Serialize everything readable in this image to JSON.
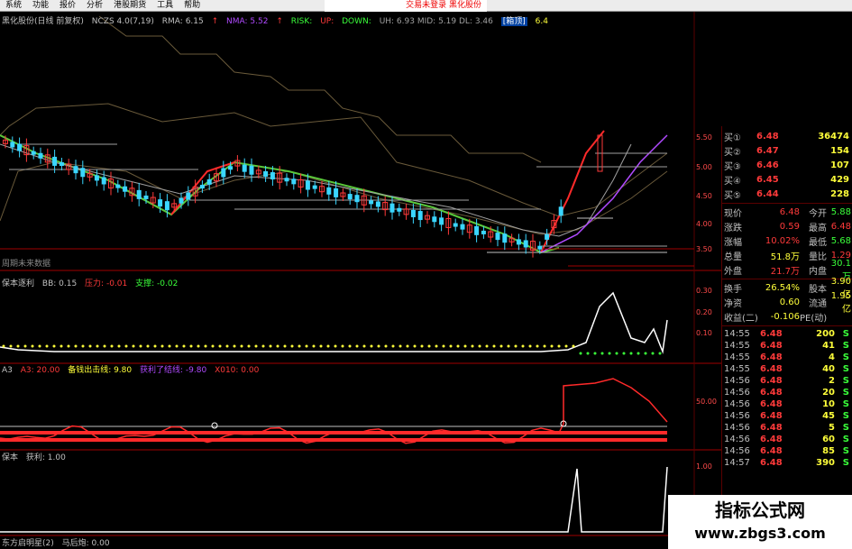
{
  "menu": [
    "系统",
    "功能",
    "报价",
    "分析",
    "港股期货",
    "工具",
    "帮助"
  ],
  "trade_text": "交易未登录  黑化股份",
  "price_header": {
    "title": "黑化股份(日线 前复权)",
    "ncz": "NCZS 4.0(7,19)",
    "rma": "RMA: 6.15",
    "nma": "NMA: 5.52",
    "risk": "RISK:",
    "up": "UP:",
    "down": "DOWN:",
    "stats": "UH: 6.93  MID: 5.19  DL: 3.46",
    "tag": "[箱顶]",
    "tag_val": "6.4"
  },
  "subtitle_main": "周期未来数据",
  "ind1": {
    "name": "保本逐利",
    "bb": "BB: 0.15",
    "yl": "压力: -0.01",
    "zc": "支撑: -0.02"
  },
  "ind2": {
    "name": "A3",
    "a3": "A3: 20.00",
    "cj": "备钱出击线: 9.80",
    "hl": "获利了结线: -9.80",
    "x": "X010: 0.00"
  },
  "ind3": {
    "name": "保本",
    "gain": "获利: 1.00"
  },
  "ind4": {
    "name": "东方启明星(2)",
    "mp": "马后炮: 0.00"
  },
  "axis_main": [
    "5.50",
    "5.00",
    "4.50",
    "4.00",
    "3.50"
  ],
  "axis_ind1": [
    "0.30",
    "0.20",
    "0.10"
  ],
  "axis_ind2": [
    "50.00"
  ],
  "axis_ind3": [
    "1.00"
  ],
  "quotes": [
    {
      "label": "买①",
      "price": "6.48",
      "vol": "36474"
    },
    {
      "label": "买②",
      "price": "6.47",
      "vol": "154"
    },
    {
      "label": "买③",
      "price": "6.46",
      "vol": "107"
    },
    {
      "label": "买④",
      "price": "6.45",
      "vol": "429"
    },
    {
      "label": "买⑤",
      "price": "6.44",
      "vol": "228"
    }
  ],
  "stats": [
    {
      "l1": "现价",
      "v1": "6.48",
      "c1": "#ff3a3a",
      "l2": "今开",
      "v2": "5.88",
      "c2": "#3aff3a"
    },
    {
      "l1": "涨跌",
      "v1": "0.59",
      "c1": "#ff3a3a",
      "l2": "最高",
      "v2": "6.48",
      "c2": "#ff3a3a"
    },
    {
      "l1": "涨幅",
      "v1": "10.02%",
      "c1": "#ff3a3a",
      "l2": "最低",
      "v2": "5.68",
      "c2": "#3aff3a"
    },
    {
      "l1": "总量",
      "v1": "51.8万",
      "c1": "#ffff3a",
      "l2": "量比",
      "v2": "1.29",
      "c2": "#ff3a3a"
    },
    {
      "l1": "外盘",
      "v1": "21.7万",
      "c1": "#ff3a3a",
      "l2": "内盘",
      "v2": "30.1万",
      "c2": "#3aff3a"
    }
  ],
  "stats2": [
    {
      "l1": "换手",
      "v1": "26.54%",
      "c1": "#ffff3a",
      "l2": "股本",
      "v2": "3.90亿",
      "c2": "#ffff3a"
    },
    {
      "l1": "净资",
      "v1": "0.60",
      "c1": "#ffff3a",
      "l2": "流通",
      "v2": "1.95亿",
      "c2": "#ffff3a"
    },
    {
      "l1": "收益(二)",
      "v1": "-0.106",
      "c1": "#ffff3a",
      "l2": "PE(动)",
      "v2": "",
      "c2": "#ffff3a"
    }
  ],
  "ticks": [
    {
      "t": "14:55",
      "p": "6.48",
      "v": "200",
      "s": "S"
    },
    {
      "t": "14:55",
      "p": "6.48",
      "v": "41",
      "s": "S"
    },
    {
      "t": "14:55",
      "p": "6.48",
      "v": "4",
      "s": "S"
    },
    {
      "t": "14:55",
      "p": "6.48",
      "v": "40",
      "s": "S"
    },
    {
      "t": "14:56",
      "p": "6.48",
      "v": "2",
      "s": "S"
    },
    {
      "t": "14:56",
      "p": "6.48",
      "v": "20",
      "s": "S"
    },
    {
      "t": "14:56",
      "p": "6.48",
      "v": "10",
      "s": "S"
    },
    {
      "t": "14:56",
      "p": "6.48",
      "v": "45",
      "s": "S"
    },
    {
      "t": "14:56",
      "p": "6.48",
      "v": "5",
      "s": "S"
    },
    {
      "t": "14:56",
      "p": "6.48",
      "v": "60",
      "s": "S"
    },
    {
      "t": "14:56",
      "p": "6.48",
      "v": "85",
      "s": "S"
    },
    {
      "t": "14:57",
      "p": "6.48",
      "v": "390",
      "s": "S"
    }
  ],
  "watermark": {
    "line1": "指标公式网",
    "line2": "www.zbgs3.com"
  },
  "colors": {
    "up": "#ff3a3a",
    "down": "#3aff3a",
    "accent": "#ffff3a",
    "grid": "#5a0000"
  }
}
